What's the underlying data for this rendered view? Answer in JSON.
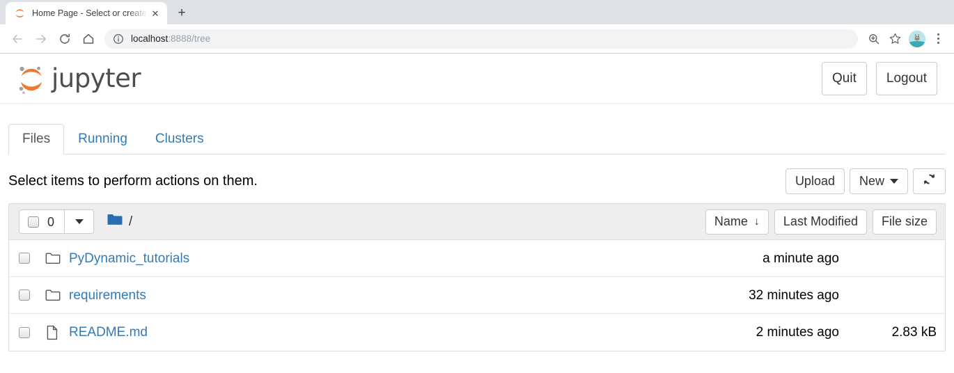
{
  "browser": {
    "tab": {
      "title": "Home Page - Select or create",
      "favicon_icon": "jupyter-favicon",
      "close_label": "✕"
    },
    "new_tab_label": "+",
    "nav": {
      "back_icon": "back-arrow-icon",
      "forward_icon": "forward-arrow-icon",
      "reload_icon": "reload-icon",
      "home_icon": "home-icon"
    },
    "omnibox": {
      "info_icon": "site-info-icon",
      "host": "localhost",
      "path": ":8888/tree"
    },
    "toolbar_right": {
      "zoom_icon": "zoom-in-icon",
      "bookmark_icon": "star-icon",
      "avatar_icon": "profile-avatar",
      "menu_icon": "three-dot-menu-icon"
    }
  },
  "header": {
    "logo_text": "jupyter",
    "logo_icon": "jupyter-logo",
    "quit_label": "Quit",
    "logout_label": "Logout"
  },
  "tabs": [
    {
      "label": "Files",
      "active": true
    },
    {
      "label": "Running",
      "active": false
    },
    {
      "label": "Clusters",
      "active": false
    }
  ],
  "actionbar": {
    "hint": "Select items to perform actions on them.",
    "upload_label": "Upload",
    "new_label": "New",
    "refresh_icon": "refresh-icon"
  },
  "filelist": {
    "selected_count": "0",
    "folder_icon": "breadcrumb-folder-icon",
    "breadcrumb_path": "/",
    "sort": {
      "name_label": "Name",
      "name_sort_arrow": "↓",
      "modified_label": "Last Modified",
      "size_label": "File size"
    },
    "rows": [
      {
        "icon": "folder-icon",
        "name": "PyDynamic_tutorials",
        "modified": "a minute ago",
        "size": ""
      },
      {
        "icon": "folder-icon",
        "name": "requirements",
        "modified": "32 minutes ago",
        "size": ""
      },
      {
        "icon": "file-icon",
        "name": "README.md",
        "modified": "2 minutes ago",
        "size": "2.83 kB"
      }
    ]
  },
  "colors": {
    "link_blue": "#337ab7",
    "jupyter_orange": "#f37726",
    "logo_gray": "#4e4e4e",
    "folder_blue": "#2b6cb0",
    "header_bg": "#eeeeee"
  }
}
